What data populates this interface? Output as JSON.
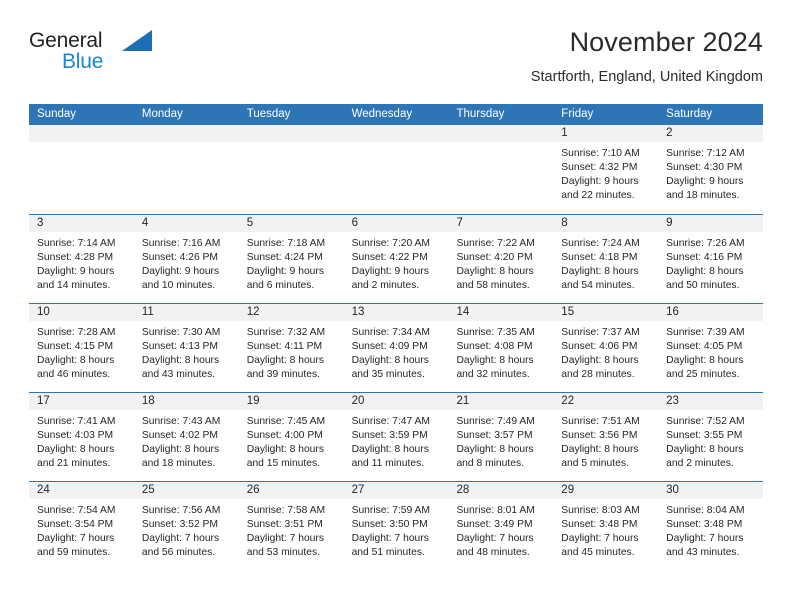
{
  "brand": {
    "name_part1": "General",
    "name_part2": "Blue",
    "triangle_color": "#1c6fb5",
    "blue_text_color": "#1787d4"
  },
  "header": {
    "title": "November 2024",
    "subtitle": "Startforth, England, United Kingdom"
  },
  "theme": {
    "header_blue": "#2e75b6",
    "daynum_strip_gray": "#f2f2f2",
    "text": "#262626"
  },
  "calendar": {
    "weekdays": [
      "Sunday",
      "Monday",
      "Tuesday",
      "Wednesday",
      "Thursday",
      "Friday",
      "Saturday"
    ],
    "weeks": [
      [
        {
          "day": "",
          "lines": []
        },
        {
          "day": "",
          "lines": []
        },
        {
          "day": "",
          "lines": []
        },
        {
          "day": "",
          "lines": []
        },
        {
          "day": "",
          "lines": []
        },
        {
          "day": "1",
          "lines": [
            "Sunrise: 7:10 AM",
            "Sunset: 4:32 PM",
            "Daylight: 9 hours",
            "and 22 minutes."
          ]
        },
        {
          "day": "2",
          "lines": [
            "Sunrise: 7:12 AM",
            "Sunset: 4:30 PM",
            "Daylight: 9 hours",
            "and 18 minutes."
          ]
        }
      ],
      [
        {
          "day": "3",
          "lines": [
            "Sunrise: 7:14 AM",
            "Sunset: 4:28 PM",
            "Daylight: 9 hours",
            "and 14 minutes."
          ]
        },
        {
          "day": "4",
          "lines": [
            "Sunrise: 7:16 AM",
            "Sunset: 4:26 PM",
            "Daylight: 9 hours",
            "and 10 minutes."
          ]
        },
        {
          "day": "5",
          "lines": [
            "Sunrise: 7:18 AM",
            "Sunset: 4:24 PM",
            "Daylight: 9 hours",
            "and 6 minutes."
          ]
        },
        {
          "day": "6",
          "lines": [
            "Sunrise: 7:20 AM",
            "Sunset: 4:22 PM",
            "Daylight: 9 hours",
            "and 2 minutes."
          ]
        },
        {
          "day": "7",
          "lines": [
            "Sunrise: 7:22 AM",
            "Sunset: 4:20 PM",
            "Daylight: 8 hours",
            "and 58 minutes."
          ]
        },
        {
          "day": "8",
          "lines": [
            "Sunrise: 7:24 AM",
            "Sunset: 4:18 PM",
            "Daylight: 8 hours",
            "and 54 minutes."
          ]
        },
        {
          "day": "9",
          "lines": [
            "Sunrise: 7:26 AM",
            "Sunset: 4:16 PM",
            "Daylight: 8 hours",
            "and 50 minutes."
          ]
        }
      ],
      [
        {
          "day": "10",
          "lines": [
            "Sunrise: 7:28 AM",
            "Sunset: 4:15 PM",
            "Daylight: 8 hours",
            "and 46 minutes."
          ]
        },
        {
          "day": "11",
          "lines": [
            "Sunrise: 7:30 AM",
            "Sunset: 4:13 PM",
            "Daylight: 8 hours",
            "and 43 minutes."
          ]
        },
        {
          "day": "12",
          "lines": [
            "Sunrise: 7:32 AM",
            "Sunset: 4:11 PM",
            "Daylight: 8 hours",
            "and 39 minutes."
          ]
        },
        {
          "day": "13",
          "lines": [
            "Sunrise: 7:34 AM",
            "Sunset: 4:09 PM",
            "Daylight: 8 hours",
            "and 35 minutes."
          ]
        },
        {
          "day": "14",
          "lines": [
            "Sunrise: 7:35 AM",
            "Sunset: 4:08 PM",
            "Daylight: 8 hours",
            "and 32 minutes."
          ]
        },
        {
          "day": "15",
          "lines": [
            "Sunrise: 7:37 AM",
            "Sunset: 4:06 PM",
            "Daylight: 8 hours",
            "and 28 minutes."
          ]
        },
        {
          "day": "16",
          "lines": [
            "Sunrise: 7:39 AM",
            "Sunset: 4:05 PM",
            "Daylight: 8 hours",
            "and 25 minutes."
          ]
        }
      ],
      [
        {
          "day": "17",
          "lines": [
            "Sunrise: 7:41 AM",
            "Sunset: 4:03 PM",
            "Daylight: 8 hours",
            "and 21 minutes."
          ]
        },
        {
          "day": "18",
          "lines": [
            "Sunrise: 7:43 AM",
            "Sunset: 4:02 PM",
            "Daylight: 8 hours",
            "and 18 minutes."
          ]
        },
        {
          "day": "19",
          "lines": [
            "Sunrise: 7:45 AM",
            "Sunset: 4:00 PM",
            "Daylight: 8 hours",
            "and 15 minutes."
          ]
        },
        {
          "day": "20",
          "lines": [
            "Sunrise: 7:47 AM",
            "Sunset: 3:59 PM",
            "Daylight: 8 hours",
            "and 11 minutes."
          ]
        },
        {
          "day": "21",
          "lines": [
            "Sunrise: 7:49 AM",
            "Sunset: 3:57 PM",
            "Daylight: 8 hours",
            "and 8 minutes."
          ]
        },
        {
          "day": "22",
          "lines": [
            "Sunrise: 7:51 AM",
            "Sunset: 3:56 PM",
            "Daylight: 8 hours",
            "and 5 minutes."
          ]
        },
        {
          "day": "23",
          "lines": [
            "Sunrise: 7:52 AM",
            "Sunset: 3:55 PM",
            "Daylight: 8 hours",
            "and 2 minutes."
          ]
        }
      ],
      [
        {
          "day": "24",
          "lines": [
            "Sunrise: 7:54 AM",
            "Sunset: 3:54 PM",
            "Daylight: 7 hours",
            "and 59 minutes."
          ]
        },
        {
          "day": "25",
          "lines": [
            "Sunrise: 7:56 AM",
            "Sunset: 3:52 PM",
            "Daylight: 7 hours",
            "and 56 minutes."
          ]
        },
        {
          "day": "26",
          "lines": [
            "Sunrise: 7:58 AM",
            "Sunset: 3:51 PM",
            "Daylight: 7 hours",
            "and 53 minutes."
          ]
        },
        {
          "day": "27",
          "lines": [
            "Sunrise: 7:59 AM",
            "Sunset: 3:50 PM",
            "Daylight: 7 hours",
            "and 51 minutes."
          ]
        },
        {
          "day": "28",
          "lines": [
            "Sunrise: 8:01 AM",
            "Sunset: 3:49 PM",
            "Daylight: 7 hours",
            "and 48 minutes."
          ]
        },
        {
          "day": "29",
          "lines": [
            "Sunrise: 8:03 AM",
            "Sunset: 3:48 PM",
            "Daylight: 7 hours",
            "and 45 minutes."
          ]
        },
        {
          "day": "30",
          "lines": [
            "Sunrise: 8:04 AM",
            "Sunset: 3:48 PM",
            "Daylight: 7 hours",
            "and 43 minutes."
          ]
        }
      ]
    ]
  }
}
